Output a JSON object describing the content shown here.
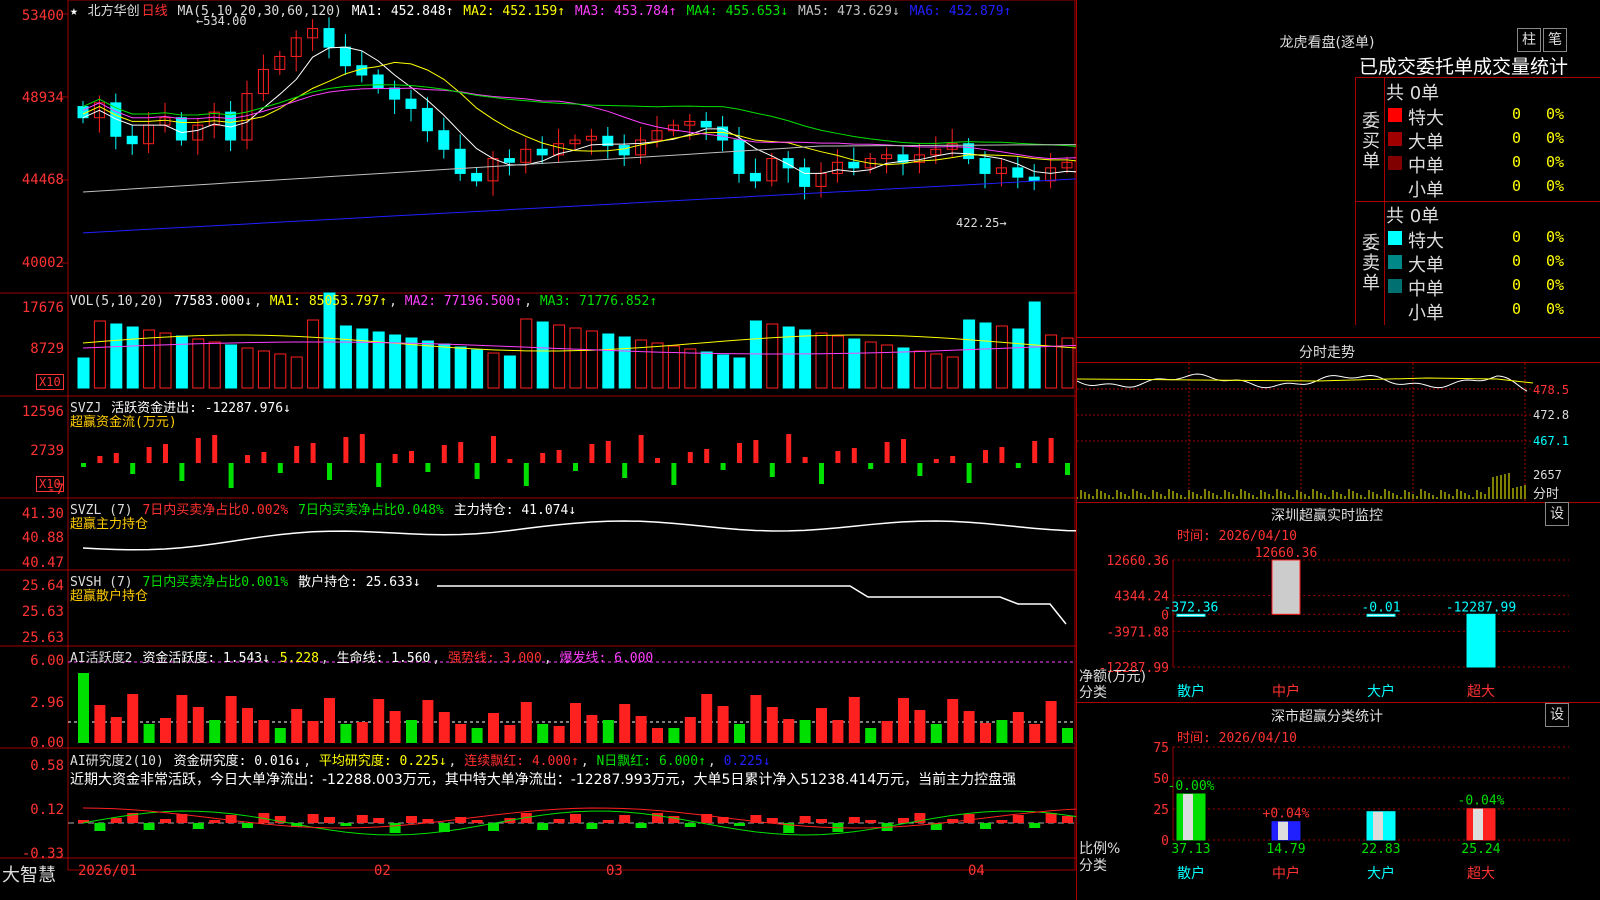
{
  "colors": {
    "up": "#ff2020",
    "down": "#00ffff",
    "ma1": "#ffffff",
    "ma2": "#ffff00",
    "ma3": "#ff40ff",
    "ma4": "#00e000",
    "ma5": "#c0c0c0",
    "ma6": "#2020ff",
    "grid": "#a00000"
  },
  "main": {
    "symbol": "北方华创",
    "period": "日线",
    "ma_label": "MA(5,10,20,30,60,120)",
    "ma_values": [
      {
        "name": "MA1",
        "text": "MA1: 452.848↑",
        "color": "#ffffff"
      },
      {
        "name": "MA2",
        "text": "MA2: 452.159↑",
        "color": "#ffff00"
      },
      {
        "name": "MA3",
        "text": "MA3: 453.784↑",
        "color": "#ff40ff"
      },
      {
        "name": "MA4",
        "text": "MA4: 455.653↓",
        "color": "#00e000"
      },
      {
        "name": "MA5",
        "text": "MA5: 473.629↓",
        "color": "#c0c0c0"
      },
      {
        "name": "MA6",
        "text": "MA6: 452.879↑",
        "color": "#2020ff"
      }
    ],
    "y_ticks": [
      "53400",
      "48934",
      "44468",
      "40002"
    ],
    "high_label": "534.00",
    "low_label": "422.25"
  },
  "vol": {
    "label": "VOL(5,10,20)",
    "value": "77583.000↓",
    "ma1": "MA1: 85053.797↑",
    "ma2": "MA2: 77196.500↑",
    "ma3": "MA3: 71776.852↑",
    "y_ticks": [
      "17676",
      "8729"
    ],
    "unit": "X10"
  },
  "svzj": {
    "label": "SVZJ",
    "text": "活跃资金进出: -12287.976↓",
    "sub": "超赢资金流(万元)",
    "y_ticks": [
      "12596",
      "2739",
      "-7"
    ],
    "unit": "X10"
  },
  "svzl": {
    "label": "SVZL (7)",
    "a": "7日内买卖净占比0.002%",
    "b": "7日内买卖净占比0.048%",
    "c": "主力持仓: 41.074↓",
    "sub": "超赢主力持仓",
    "y_ticks": [
      "41.30",
      "40.88",
      "40.47"
    ]
  },
  "svsh": {
    "label": "SVSH (7)",
    "a": "7日内买卖净占比0.001%",
    "c": "散户持仓: 25.633↓",
    "sub": "超赢散户持仓",
    "y_ticks": [
      "25.64",
      "25.63",
      "25.63"
    ]
  },
  "ai1": {
    "label": "AI活跃度2",
    "a": "资金活跃度: 1.543↓",
    "b": "5.228",
    "c": "生命线: 1.560",
    "d": "强势线: 3.000",
    "e": "爆发线: 6.000",
    "y_ticks": [
      "6.00",
      "2.96",
      "0.00"
    ]
  },
  "ai2": {
    "label": "AI研究度2(10)",
    "a": "资金研究度: 0.016↓",
    "b": "平均研究度: 0.225↓",
    "c": "连续飘红: 4.000↑",
    "d": "N日飘红: 6.000↑",
    "e": "0.225↓",
    "note": "近期大资金非常活跃，今日大单净流出：-12288.003万元，其中特大单净流出：-12287.993万元，大单5日累计净入51238.414万元，当前主力控盘强",
    "y_ticks": [
      "0.58",
      "0.12",
      "-0.33"
    ]
  },
  "xaxis": {
    "labels": [
      "2026/01",
      "02",
      "03",
      "04"
    ],
    "brand": "大智慧"
  },
  "right": {
    "dragon": {
      "title": "龙虎看盘(逐单)",
      "btn1": "柱",
      "btn2": "笔",
      "header": "已成交委托单成交量统计",
      "buy_side": "委买单",
      "sell_side": "委卖单",
      "buy_total": "共 0单",
      "sell_total": "共 0单",
      "buy_rows": [
        {
          "label": "特大",
          "count": "0",
          "pct": "0%",
          "color": "#ff0000"
        },
        {
          "label": "大单",
          "count": "0",
          "pct": "0%",
          "color": "#a00000"
        },
        {
          "label": "中单",
          "count": "0",
          "pct": "0%",
          "color": "#800000"
        },
        {
          "label": "小单",
          "count": "0",
          "pct": "0%",
          "color": ""
        }
      ],
      "sell_rows": [
        {
          "label": "特大",
          "count": "0",
          "pct": "0%",
          "color": "#00ffff"
        },
        {
          "label": "大单",
          "count": "0",
          "pct": "0%",
          "color": "#008888"
        },
        {
          "label": "中单",
          "count": "0",
          "pct": "0%",
          "color": "#007070"
        },
        {
          "label": "小单",
          "count": "0",
          "pct": "0%",
          "color": ""
        }
      ]
    },
    "intraday": {
      "title": "分时走势",
      "p1": "478.5",
      "p2": "472.8",
      "p3": "467.1",
      "v": "2657",
      "unit": "分时"
    },
    "monitor": {
      "title": "深圳超赢实时监控",
      "btn": "设",
      "time": "时间: 2026/04/10",
      "y_ticks": [
        "12660.36",
        "4344.24",
        "0",
        "-3971.88",
        "-12287.99"
      ],
      "ylabel": "净额(万元)",
      "xlabel": "分类",
      "categories": [
        "散户",
        "中户",
        "大户",
        "超大"
      ],
      "values": [
        -372.36,
        12660.36,
        -0.01,
        -12287.99
      ],
      "value_labels": [
        "-372.36",
        "12660.36",
        "-0.01",
        "-12287.99"
      ]
    },
    "stats": {
      "title": "深市超赢分类统计",
      "btn": "设",
      "time": "时间: 2026/04/10",
      "y_ticks": [
        "75",
        "50",
        "25",
        "0"
      ],
      "ylabel": "比例%",
      "xlabel": "分类",
      "categories": [
        "散户",
        "中户",
        "大户",
        "超大"
      ],
      "values": [
        37.13,
        14.79,
        22.83,
        25.24
      ],
      "changes": [
        "-0.00%",
        "+0.04%",
        "",
        "-0.04%"
      ]
    }
  },
  "chart_data": {
    "type": "bar",
    "title": "北方华创 日线",
    "candles_close": [
      482,
      490,
      472,
      468,
      478,
      482,
      470,
      478,
      485,
      470,
      495,
      508,
      515,
      525,
      530,
      520,
      510,
      505,
      498,
      492,
      487,
      475,
      465,
      452,
      448,
      460,
      458,
      465,
      462,
      468,
      470,
      472,
      467,
      462,
      470,
      475,
      478,
      480,
      477,
      470,
      452,
      448,
      460,
      455,
      445,
      452,
      458,
      455,
      460,
      462,
      458,
      462,
      465,
      468,
      460,
      452,
      455,
      450,
      448,
      455,
      458,
      452,
      450,
      438,
      432,
      448,
      468,
      475
    ],
    "categories": [
      "散户",
      "中户",
      "大户",
      "超大"
    ],
    "values": [
      -372.36,
      12660.36,
      -0.01,
      -12287.99
    ]
  }
}
